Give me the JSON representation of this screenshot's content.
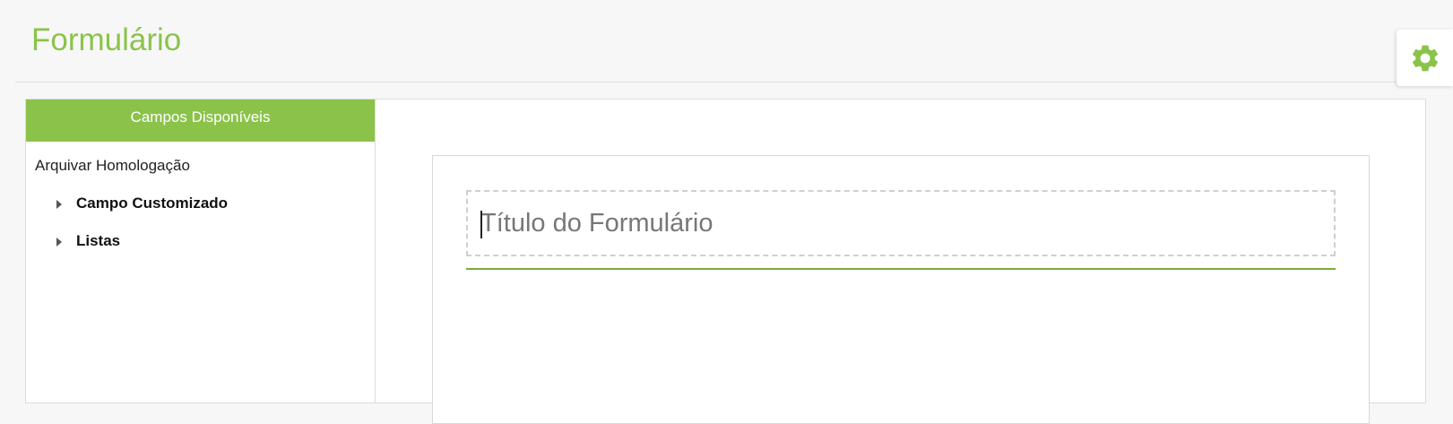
{
  "page": {
    "title": "Formulário"
  },
  "settings": {
    "icon": "gear-icon",
    "color": "#8bc34a"
  },
  "sidebar": {
    "header": "Campos Disponíveis",
    "group_label": "Arquivar Homologação",
    "items": [
      {
        "label": "Campo Customizado",
        "icon": "caret-right-icon"
      },
      {
        "label": "Listas",
        "icon": "caret-right-icon"
      }
    ]
  },
  "form": {
    "title_value": "",
    "title_placeholder": "Título do Formulário"
  },
  "colors": {
    "accent": "#8bc34a",
    "underline": "#7aad3a",
    "border": "#dcdcdc"
  }
}
